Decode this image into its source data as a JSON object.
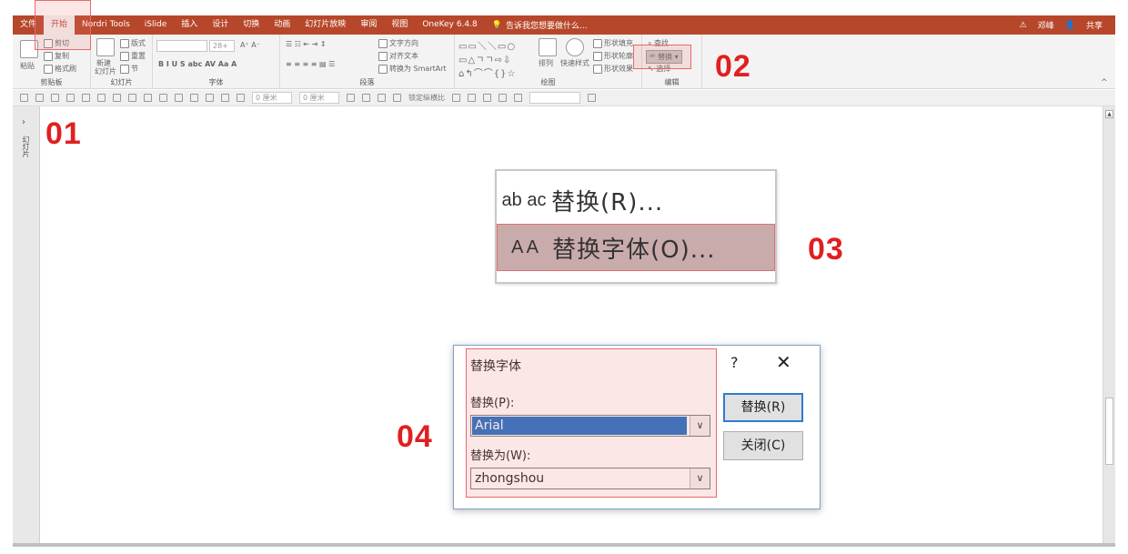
{
  "tabs": [
    "文件",
    "开始",
    "Nordri Tools",
    "iSlide",
    "插入",
    "设计",
    "切换",
    "动画",
    "幻灯片放映",
    "审阅",
    "视图",
    "OneKey 6.4.8"
  ],
  "active_tab": "开始",
  "tell_me": "告诉我您想要做什么...",
  "user": "邓峰",
  "share": "共享",
  "ribbon": {
    "clipboard": {
      "paste": "粘贴",
      "cut": "剪切",
      "copy": "复制",
      "format_painter": "格式刷",
      "label": "剪贴板"
    },
    "slides": {
      "new_slide": "新建",
      "new_slide2": "幻灯片",
      "layout": "版式",
      "reset": "重置",
      "section": "节",
      "label": "幻灯片"
    },
    "font": {
      "size": "28+",
      "label": "字体"
    },
    "paragraph": {
      "text_direction": "文字方向",
      "align_text": "对齐文本",
      "convert_smartart": "转换为 SmartArt",
      "label": "段落"
    },
    "drawing": {
      "arrange": "排列",
      "quick_styles": "快速样式",
      "shape_fill": "形状填充",
      "shape_outline": "形状轮廓",
      "shape_effects": "形状效果",
      "label": "绘图"
    },
    "editing": {
      "find": "查找",
      "replace": "替换",
      "select": "选择",
      "label": "编辑"
    }
  },
  "quickbar": {
    "width1": "0 厘米",
    "width2": "0 厘米",
    "lock_ratio": "锁定纵横比"
  },
  "left_panel": {
    "thumbnails": "幻灯片"
  },
  "steps": {
    "s1": "01",
    "s2": "02",
    "s3": "03",
    "s4": "04"
  },
  "menu": {
    "replace_icon": "ab ac",
    "replace_label": "替换(R)...",
    "replace_font_icon": "A A",
    "replace_font_label": "替换字体(O)..."
  },
  "dialog": {
    "title": "替换字体",
    "help": "?",
    "close": "✕",
    "replace_label": "替换(P):",
    "replace_value": "Arial",
    "with_label": "替换为(W):",
    "with_value": "zhongshou",
    "btn_replace": "替换(R)",
    "btn_close": "关闭(C)"
  }
}
